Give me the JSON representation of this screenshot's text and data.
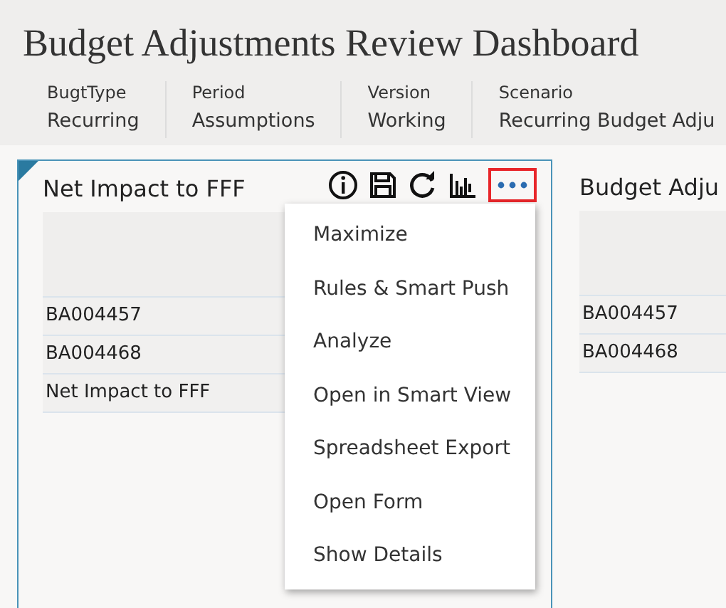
{
  "dashboard": {
    "title": "Budget Adjustments Review Dashboard"
  },
  "filters": [
    {
      "label": "BugtType",
      "value": "Recurring"
    },
    {
      "label": "Period",
      "value": "Assumptions"
    },
    {
      "label": "Version",
      "value": "Working"
    },
    {
      "label": "Scenario",
      "value": "Recurring Budget Adju"
    }
  ],
  "panels": [
    {
      "title": "Net Impact to FFF",
      "selected": true,
      "toolbar": {
        "more_highlighted": true
      },
      "rows": [
        "BA004457",
        "BA004468",
        "Net Impact to FFF"
      ]
    },
    {
      "title": "Budget Adju",
      "selected": false,
      "rows": [
        "BA004457",
        "BA004468"
      ]
    }
  ],
  "menu": {
    "items": [
      "Maximize",
      "Rules & Smart Push",
      "Analyze",
      "Open in Smart View",
      "Spreadsheet Export",
      "Open Form",
      "Show Details"
    ]
  }
}
